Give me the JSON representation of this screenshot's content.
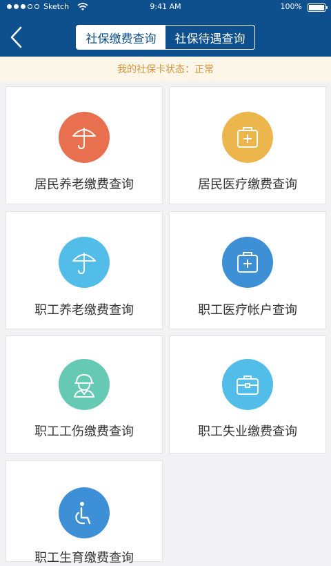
{
  "status_bar": {
    "carrier": "Sketch",
    "time": "9:41 AM",
    "battery": "100%"
  },
  "nav": {
    "back_icon": "chevron-left-icon",
    "tabs": [
      {
        "label": "社保缴费查询",
        "active": true
      },
      {
        "label": "社保待遇查询",
        "active": false
      }
    ]
  },
  "notice": {
    "text": "我的社保卡状态：正常"
  },
  "colors": {
    "header_bg": "#0e4f8e",
    "notice_text": "#d6923a",
    "orange": "#e9704f",
    "yellow": "#ecb64d",
    "sky": "#52bde9",
    "blue": "#3d8fd6",
    "green": "#66c9b4"
  },
  "cards": [
    {
      "label": "居民养老缴费查询",
      "icon": "umbrella-icon",
      "color": "#e9704f"
    },
    {
      "label": "居民医疗缴费查询",
      "icon": "medical-kit-icon",
      "color": "#ecb64d"
    },
    {
      "label": "职工养老缴费查询",
      "icon": "umbrella-icon",
      "color": "#52bde9"
    },
    {
      "label": "职工医疗帐户查询",
      "icon": "medical-kit-icon",
      "color": "#3d8fd6"
    },
    {
      "label": "职工工伤缴费查询",
      "icon": "worker-helmet-icon",
      "color": "#66c9b4"
    },
    {
      "label": "职工失业缴费查询",
      "icon": "briefcase-icon",
      "color": "#52bde9"
    },
    {
      "label": "职工生育缴费查询",
      "icon": "wheelchair-icon",
      "color": "#3d8fd6"
    }
  ]
}
